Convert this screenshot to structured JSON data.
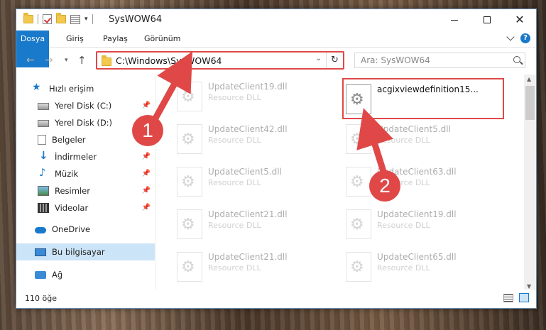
{
  "window": {
    "title": "SysWOW64",
    "controls": {
      "minimize": "—",
      "maximize": "□",
      "close": "✕"
    }
  },
  "ribbon": {
    "tabs": [
      "Dosya",
      "Giriş",
      "Paylaş",
      "Görünüm"
    ],
    "help": "?"
  },
  "address": {
    "path": "C:\\Windows\\SysWOW64",
    "search_placeholder": "Ara: SysWOW64"
  },
  "sidebar": {
    "items": [
      {
        "label": "Hızlı erişim",
        "icon": "star-icon"
      },
      {
        "label": "Yerel Disk (C:)",
        "icon": "disk-icon",
        "pinned": true
      },
      {
        "label": "Yerel Disk (D:)",
        "icon": "disk-icon"
      },
      {
        "label": "Belgeler",
        "icon": "documents-icon"
      },
      {
        "label": "İndirmeler",
        "icon": "download-icon",
        "pinned": true
      },
      {
        "label": "Müzik",
        "icon": "music-icon",
        "pinned": true
      },
      {
        "label": "Resimler",
        "icon": "pictures-icon",
        "pinned": true
      },
      {
        "label": "Videolar",
        "icon": "video-icon",
        "pinned": true
      },
      {
        "label": "OneDrive",
        "icon": "cloud-icon"
      },
      {
        "label": "Bu bilgisayar",
        "icon": "pc-icon",
        "selected": true
      },
      {
        "label": "Ağ",
        "icon": "network-icon"
      }
    ]
  },
  "files": [
    {
      "name": "UpdateClient19.dll",
      "type": "Resource DLL"
    },
    {
      "name": "acgixviewdefinition15...",
      "type": ""
    },
    {
      "name": "UpdateClient42.dll",
      "type": "Resource DLL"
    },
    {
      "name": "UpdateClient5.dll",
      "type": "Resource DLL"
    },
    {
      "name": "UpdateClient5.dll",
      "type": "Resource DLL"
    },
    {
      "name": "UpdateClient63.dll",
      "type": "Resource DLL"
    },
    {
      "name": "UpdateClient21.dll",
      "type": "Resource DLL"
    },
    {
      "name": "UpdateClient19.dll",
      "type": "Resource DLL"
    },
    {
      "name": "UpdateClient21.dll",
      "type": "Resource DLL"
    },
    {
      "name": "UpdateClient65.dll",
      "type": "Resource DLL"
    }
  ],
  "status": {
    "count": "110 öğe"
  },
  "annotations": {
    "step1": "1",
    "step2": "2"
  }
}
